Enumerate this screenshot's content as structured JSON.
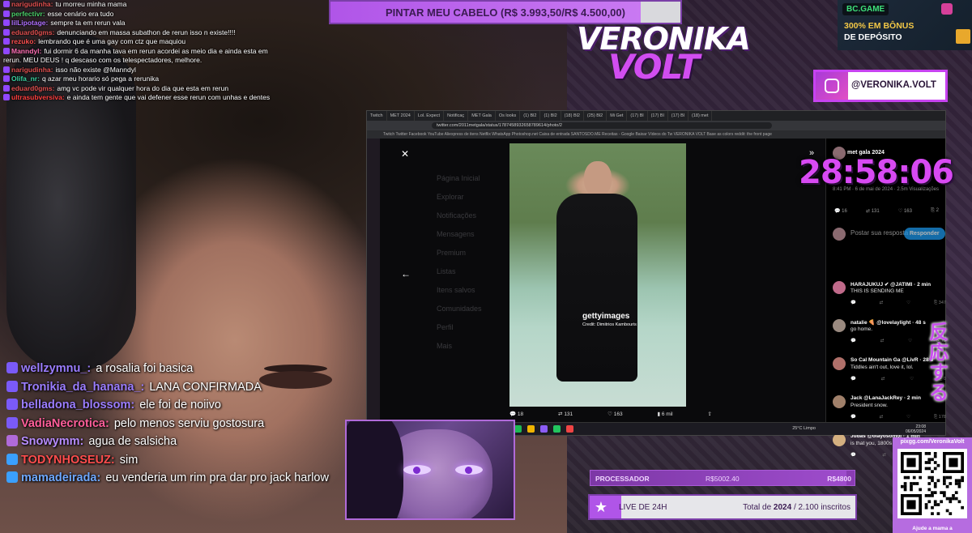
{
  "goal_banner": {
    "text": "PINTAR MEU CABELO (R$ 3.993,50/R$ 4.500,00)",
    "progress": 0.887
  },
  "logo": {
    "line1": "VERONIKA",
    "line2": "VOLT"
  },
  "ad": {
    "brand": "BC.GAME",
    "line1": "300% EM BÔNUS",
    "line2": "DE DEPÓSITO"
  },
  "instagram": {
    "handle": "@VERONIKA.VOLT"
  },
  "timer": "28:58:06",
  "reaction_text": "反応する",
  "chat_small": [
    {
      "user": "narigudinha:",
      "color": "#e05050",
      "text": "tu morreu minha mama"
    },
    {
      "user": "perfectivr:",
      "color": "#4bd06a",
      "text": "esse cenário era tudo"
    },
    {
      "user": "lilLipotage:",
      "color": "#b070ff",
      "text": "sempre ta em rerun vala"
    },
    {
      "user": "eduard0gms:",
      "color": "#e05050",
      "text": "denunciando em massa subathon de rerun isso n existe!!!!"
    },
    {
      "user": "rezuko:",
      "color": "#ff5050",
      "text": "lembrando que é uma gay com ctz que maquiou"
    },
    {
      "user": "Manndyl:",
      "color": "#ff6fb5",
      "text": "fui dormir 6 da manha tava em rerun acordei as meio dia e ainda esta em rerun. MEU DEUS ! q descaso com os telespectadores, melhore."
    },
    {
      "user": "narigudinha:",
      "color": "#e05050",
      "text": "isso não existe @Manndyl"
    },
    {
      "user": "Olifa_nr:",
      "color": "#3ad1a0",
      "text": "q azar meu horario só pega a rerunika"
    },
    {
      "user": "eduard0gms:",
      "color": "#e05050",
      "text": "amg vc pode vir qualquer hora do dia que esta em rerun"
    },
    {
      "user": "ultrasubversiva:",
      "color": "#ff4040",
      "text": "e ainda tem gente que vai defener esse rerun com unhas e dentes"
    }
  ],
  "chat_big": [
    {
      "user": "wellzymnu_:",
      "color": "#9b7dff",
      "text": "a rosalia foi basica"
    },
    {
      "user": "Tronikia_da_hanana_:",
      "color": "#9b7dff",
      "text": "LANA CONFIRMADA"
    },
    {
      "user": "belladona_blossom:",
      "color": "#9b7dff",
      "text": "ele foi de noiivo"
    },
    {
      "user": "VadiaNecrotica:",
      "color": "#ff5e9a",
      "text": "pelo menos serviu gostosura"
    },
    {
      "user": "Snowymm:",
      "color": "#b78cff",
      "text": "agua de salsicha"
    },
    {
      "user": "TODYNHOSEUZ:",
      "color": "#ff4d4d",
      "text": "sim"
    },
    {
      "user": "mamadeirada:",
      "color": "#6ea8ff",
      "text": "eu venderia um rim pra dar pro jack harlow"
    }
  ],
  "browser": {
    "tabs": [
      "Twitch",
      "MET 2024",
      "Lol. Expect",
      "Notificaç",
      "MET Gala",
      "Os looks",
      "(1) Bl2",
      "(1) Bl2",
      "(18) Bl2",
      "(25) Bl2",
      "Mi Get",
      "(17) Bl",
      "(17) Bl",
      "(17) Bl",
      "(18) met"
    ],
    "url": "twitter.com/2011metgala/status/1787458932658789614/photo/2",
    "bookmarks": "Twitch  Twitter  Facebook  YouTube  Aliexpress de itens  Netflix  WhatsApp  Photoshop.net  Caixa de entrada  SANTOSDO.ME  Receitas - Google  Baixar Vídeos do Tw  VERONIKA VOLT  Base as colors  reddit: the front page",
    "nav": [
      "Página Inicial",
      "Explorar",
      "Notificações",
      "Mensagens",
      "Premium",
      "Listas",
      "Itens salvos",
      "Comunidades",
      "Perfil",
      "Mais"
    ],
    "photo": {
      "watermark": "gettyimages",
      "credit": "Credit: Dimitrios Kambouris"
    },
    "actions": {
      "replies": "18",
      "reposts": "131",
      "likes": "163",
      "views": "6 mil"
    },
    "post": {
      "account": "met gala 2024",
      "meta": "8:41 PM · 6 de mai de 2024 · 2.5m Visualizações"
    },
    "stats": [
      "16",
      "131",
      "163",
      "2"
    ],
    "reply_placeholder": "Postar sua resposta",
    "reply_button": "Responder",
    "replies": [
      {
        "name": "HARAJUKUJ ✔ @JATIMI · 2 min",
        "text": "THIS IS SENDING ME",
        "s": [
          "",
          "",
          "",
          "347"
        ]
      },
      {
        "name": "natalie 🍕 @lovelaylight · 48 s",
        "text": "go home.",
        "s": [
          "",
          "",
          "",
          "75"
        ]
      },
      {
        "name": "So Cal Mountain Ga @LivR · 28 s",
        "text": "Tiddles ain't out, love it, lol.",
        "s": [
          "",
          "",
          "",
          "0"
        ]
      },
      {
        "name": "Jack @LanaJackRey · 2 min",
        "text": "President snow.",
        "s": [
          "",
          "",
          "",
          "178"
        ]
      },
      {
        "name": "Judas @olayosomol · 1 min",
        "text": "is that you, 1800s English man.",
        "s": [
          "",
          "",
          "",
          ""
        ]
      }
    ],
    "taskbar": {
      "weather": "25°C Limpo",
      "time": "23:08",
      "date": "06/05/2024",
      "lang": "POR PTB2"
    }
  },
  "processador": {
    "label": "PROCESSADOR",
    "current": "R$5002.40",
    "target": "R$4800"
  },
  "subs": {
    "left": "LIVE DE 24H",
    "prefix": "Total de",
    "year": "2024",
    "count": "/ 2.100 inscritos",
    "progress": 0.12
  },
  "qr": {
    "url": "pixgg.com/VeronikaVolt",
    "footer": "Ajude a mama a"
  },
  "colors": {
    "accent": "#c743f0",
    "timer": "#d84af3",
    "brand_purple": "#7b3fa8"
  }
}
